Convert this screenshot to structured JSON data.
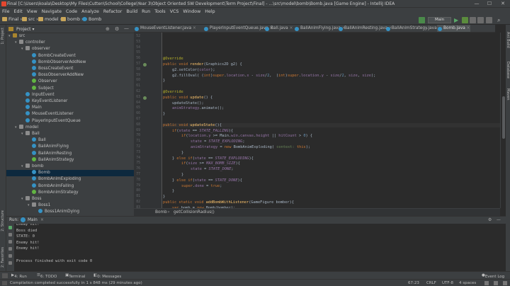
{
  "window": {
    "title": "Final [C:\\Users\\koala\\Desktop\\My Files\\Cutten\\School\\College\\Year 3\\Object Oriented SW Development\\Term Project\\Final] - ...\\src\\model\\bomb\\Bomb.java [Game Engine] - IntelliJ IDEA",
    "minimize": "—",
    "maximize": "☐",
    "close": "✕"
  },
  "menu": [
    "File",
    "Edit",
    "View",
    "Navigate",
    "Code",
    "Analyze",
    "Refactor",
    "Build",
    "Run",
    "Tools",
    "VCS",
    "Window",
    "Help"
  ],
  "breadcrumbs": [
    "Final",
    "src",
    "model",
    "bomb",
    "Bomb"
  ],
  "run_config": "Main",
  "project_panel": {
    "title": "Project"
  },
  "tree": [
    {
      "label": "src",
      "depth": 1,
      "kind": "folder",
      "arrow": "▾"
    },
    {
      "label": "controller",
      "depth": 2,
      "kind": "pkg",
      "arrow": "▾"
    },
    {
      "label": "observer",
      "depth": 3,
      "kind": "pkg",
      "arrow": "▾"
    },
    {
      "label": "BombCreateEvent",
      "depth": 4,
      "kind": "cls",
      "arrow": ""
    },
    {
      "label": "BombObserverAddNew",
      "depth": 4,
      "kind": "cls",
      "arrow": ""
    },
    {
      "label": "BossCreateEvent",
      "depth": 4,
      "kind": "cls",
      "arrow": ""
    },
    {
      "label": "BossObserverAddNew",
      "depth": 4,
      "kind": "cls",
      "arrow": ""
    },
    {
      "label": "Observer",
      "depth": 4,
      "kind": "ifc",
      "arrow": ""
    },
    {
      "label": "Subject",
      "depth": 4,
      "kind": "ifc",
      "arrow": ""
    },
    {
      "label": "InputEvent",
      "depth": 3,
      "kind": "cls",
      "arrow": ""
    },
    {
      "label": "KeyEventListener",
      "depth": 3,
      "kind": "cls",
      "arrow": ""
    },
    {
      "label": "Main",
      "depth": 3,
      "kind": "cls",
      "arrow": ""
    },
    {
      "label": "MouseEventListener",
      "depth": 3,
      "kind": "cls",
      "arrow": ""
    },
    {
      "label": "PlayerInputEventQueue",
      "depth": 3,
      "kind": "cls",
      "arrow": ""
    },
    {
      "label": "model",
      "depth": 2,
      "kind": "pkg",
      "arrow": "▾"
    },
    {
      "label": "Ball",
      "depth": 3,
      "kind": "pkg",
      "arrow": "▾"
    },
    {
      "label": "Ball",
      "depth": 4,
      "kind": "cls",
      "arrow": ""
    },
    {
      "label": "BallAnimFlying",
      "depth": 4,
      "kind": "cls",
      "arrow": ""
    },
    {
      "label": "BallAnimResting",
      "depth": 4,
      "kind": "cls",
      "arrow": ""
    },
    {
      "label": "BallAnimStrategy",
      "depth": 4,
      "kind": "ifc",
      "arrow": ""
    },
    {
      "label": "bomb",
      "depth": 3,
      "kind": "pkg",
      "arrow": "▾"
    },
    {
      "label": "Bomb",
      "depth": 4,
      "kind": "cls",
      "arrow": "",
      "selected": true
    },
    {
      "label": "BombAnimExploding",
      "depth": 4,
      "kind": "cls",
      "arrow": ""
    },
    {
      "label": "BombAnimFalling",
      "depth": 4,
      "kind": "cls",
      "arrow": ""
    },
    {
      "label": "BombAnimStrategy",
      "depth": 4,
      "kind": "ifc",
      "arrow": ""
    },
    {
      "label": "Boss",
      "depth": 3,
      "kind": "pkg",
      "arrow": "▾"
    },
    {
      "label": "Boss1",
      "depth": 4,
      "kind": "pkg",
      "arrow": "▾"
    },
    {
      "label": "Boss1AnimDying",
      "depth": 5,
      "kind": "cls",
      "arrow": ""
    }
  ],
  "tabs": [
    {
      "label": "MouseEventListener.java",
      "active": false
    },
    {
      "label": "PlayerInputEventQueue.java",
      "active": false
    },
    {
      "label": "Ball.java",
      "active": false
    },
    {
      "label": "BallAnimFlying.java",
      "active": false
    },
    {
      "label": "BallAnimResting.java",
      "active": false
    },
    {
      "label": "BallAnimStrategy.java",
      "active": false
    },
    {
      "label": "Bomb.java",
      "active": true
    }
  ],
  "line_numbers": [
    "52",
    "53",
    "54",
    "55",
    "56",
    "57",
    "58",
    "59",
    "60",
    "61",
    "62",
    "63",
    "64",
    "65",
    "66",
    "67",
    "68",
    "69",
    "70",
    "71",
    "72",
    "73",
    "74",
    "75",
    "76",
    "77",
    "78",
    "79",
    "80",
    "81",
    "82",
    "83",
    "84",
    "85",
    "86"
  ],
  "code": [
    {
      "ind": 0,
      "html": ""
    },
    {
      "ind": 0,
      "html": ""
    },
    {
      "ind": 0,
      "html": ""
    },
    {
      "ind": 0,
      "html": ""
    },
    {
      "ind": 0,
      "html": "<span class='an'>@Override</span>"
    },
    {
      "ind": 0,
      "html": "<span class='kw'>public void</span> <span class='fn'>render</span>(Graphics2D g2) {"
    },
    {
      "ind": 1,
      "html": "g2.setColor(<span class='fld'>color</span>);"
    },
    {
      "ind": 1,
      "html": "g2.fillOval( (<span class='kw'>int</span>)<span class='kw'>super</span>.<span class='fld'>location</span>.<span class='fld'>x</span> - <span class='fld'>size</span>/<span class='num'>2</span>,  (<span class='kw'>int</span>)<span class='kw'>super</span>.<span class='fld'>location</span>.<span class='fld'>y</span> - <span class='fld'>size</span>/<span class='num'>2</span>, <span class='fld'>size</span>, <span class='fld'>size</span>);"
    },
    {
      "ind": 0,
      "html": "}"
    },
    {
      "ind": 0,
      "html": ""
    },
    {
      "ind": 0,
      "html": "<span class='an'>@Override</span>"
    },
    {
      "ind": 0,
      "html": "<span class='kw'>public void</span> <span class='fn'>update</span>() {"
    },
    {
      "ind": 1,
      "html": "updateState();"
    },
    {
      "ind": 1,
      "html": "<span class='fld'>animStrategy</span>.animate();"
    },
    {
      "ind": 0,
      "html": "}"
    },
    {
      "ind": 0,
      "html": ""
    },
    {
      "ind": 0,
      "html": "<span class='kw'>public void</span> <span class='fn'>updateState</span>(){",
      "hl": true
    },
    {
      "ind": 1,
      "html": "<span class='kw'>if</span>(<span class='fld'>state</span> == <span class='fld ital'>STATE_FALLING</span>){"
    },
    {
      "ind": 2,
      "html": "<span class='kw'>if</span>(<span class='fld'>location</span>.<span class='fld'>y</span> >= Main.<span class='fld ital'>win</span>.<span class='fld'>canvas</span>.<span class='fld'>height</span> || <span class='fld'>hitCount</span> > <span class='num'>0</span>) {"
    },
    {
      "ind": 3,
      "html": "<span class='fld'>state</span> = <span class='fld ital'>STATE_EXPLODING</span>;"
    },
    {
      "ind": 3,
      "html": "<span class='fld'>animStrategy</span> = <span class='kw'>new</span> BombAnimExploding( <span class='str'>context:</span> <span class='kw'>this</span>);"
    },
    {
      "ind": 2,
      "html": "}"
    },
    {
      "ind": 1,
      "html": "} <span class='kw'>else if</span>(<span class='fld'>state</span> == <span class='fld ital'>STATE_EXPLODING</span>){"
    },
    {
      "ind": 2,
      "html": "<span class='kw'>if</span>(<span class='fld'>size</span> >= <span class='fld ital'>MAX_BOMB_SIZE</span>){"
    },
    {
      "ind": 3,
      "html": "<span class='fld'>state</span> = <span class='fld ital'>STATE_DONE</span>;"
    },
    {
      "ind": 2,
      "html": "}"
    },
    {
      "ind": 1,
      "html": "} <span class='kw'>else if</span>(<span class='fld'>state</span> == <span class='fld ital'>STATE_DONE</span>){"
    },
    {
      "ind": 2,
      "html": "<span class='kw'>super</span>.<span class='fld'>done</span> = <span class='kw'>true</span>;"
    },
    {
      "ind": 1,
      "html": "}"
    },
    {
      "ind": 0,
      "html": "}"
    },
    {
      "ind": 0,
      "html": "<span class='kw'>public static void</span> <span class='fn'>addBombWithListener</span>(GameFigure bomber){"
    },
    {
      "ind": 1,
      "html": "<span class='kw'>var</span> bomb = <span class='kw'>new</span> Bomb(bomber);"
    }
  ],
  "editor_breadcrumb": [
    "Bomb",
    "getCollisionRadius()"
  ],
  "run_panel": {
    "label": "Run:",
    "config": "Main",
    "console": [
      "Enemy hit!",
      "Boss died",
      "STATE: 0",
      "Enemy hit!",
      "Enemy hit!",
      "",
      "Process finished with exit code 0"
    ]
  },
  "left_tool_tabs": [
    "1: Project",
    "2: Structure",
    "2: Favorites"
  ],
  "right_tool_tabs": [
    "Ant Build",
    "Database",
    "Maven"
  ],
  "bottom_tabs": [
    "4: Run",
    "6: TODO",
    "Terminal",
    "0: Messages"
  ],
  "event_log": "Event Log",
  "status": {
    "message": "Compilation completed successfully in 1 s 848 ms (29 minutes ago)",
    "position": "67:23",
    "line_sep": "CRLF",
    "encoding": "UTF-8",
    "indent": "4 spaces"
  },
  "colors": {
    "accent": "#3592c4",
    "keyword": "#cc7832",
    "field": "#9876aa",
    "method": "#ffc66d",
    "annotation": "#bbb529",
    "number": "#6897bb"
  }
}
